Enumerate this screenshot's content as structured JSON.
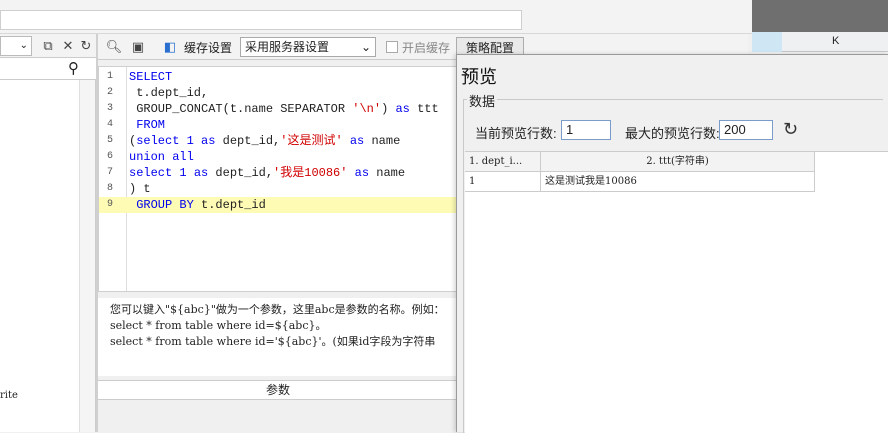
{
  "left": {
    "leftover_text": "rite"
  },
  "toolbar": {
    "cache_label": "缓存设置",
    "cache_value": "采用服务器设置",
    "enable_cache_label": "开启缓存",
    "strategy_button": "策略配置"
  },
  "grid": {
    "column_k": "K"
  },
  "editor": {
    "lines": [
      {
        "num": "1",
        "text": "SELECT"
      },
      {
        "num": "2",
        "text": " t.dept_id,"
      },
      {
        "num": "3",
        "text": " GROUP_CONCAT(t.name SEPARATOR '\\n') as ttt"
      },
      {
        "num": "4",
        "text": " FROM"
      },
      {
        "num": "5",
        "text": "(select 1 as dept_id,'这是测试' as name"
      },
      {
        "num": "6",
        "text": "union all"
      },
      {
        "num": "7",
        "text": "select 1 as dept_id,'我是10086' as name"
      },
      {
        "num": "8",
        "text": ") t"
      },
      {
        "num": "9",
        "text": " GROUP BY t.dept_id"
      }
    ]
  },
  "tip": {
    "line1": "您可以键入\"${abc}\"做为一个参数，这里abc是参数的名称。例如：",
    "line2": "select * from table where id=${abc}。",
    "line3": "select * from table where id='${abc}'。(如果id字段为字符串"
  },
  "params": {
    "header": "参数"
  },
  "preview": {
    "title": "预览",
    "group_label": "数据",
    "current_rows_label": "当前预览行数:",
    "current_rows_value": "1",
    "max_rows_label": "最大的预览行数:",
    "max_rows_value": "200",
    "columns": [
      "1. dept_i...",
      "2. ttt(字符串)"
    ],
    "rows": [
      [
        "1",
        "这是测试我是10086"
      ]
    ]
  }
}
